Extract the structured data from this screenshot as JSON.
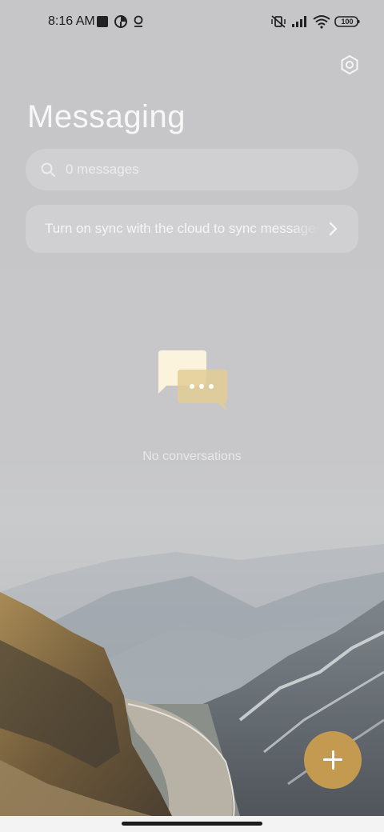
{
  "status_bar": {
    "time": "8:16 AM",
    "battery": "100"
  },
  "header": {
    "title": "Messaging"
  },
  "search": {
    "placeholder": "0 messages"
  },
  "sync_banner": {
    "text": "Turn on sync with the cloud to sync messages"
  },
  "empty_state": {
    "text": "No conversations"
  },
  "colors": {
    "accent": "#c49a50",
    "bubble_front": "#fcf3dc",
    "bubble_back": "#e2cc94"
  },
  "icons": {
    "settings": "gear-icon",
    "search": "search-icon",
    "chevron": "chevron-right-icon",
    "fab": "plus-icon",
    "empty": "chat-bubbles-icon"
  }
}
